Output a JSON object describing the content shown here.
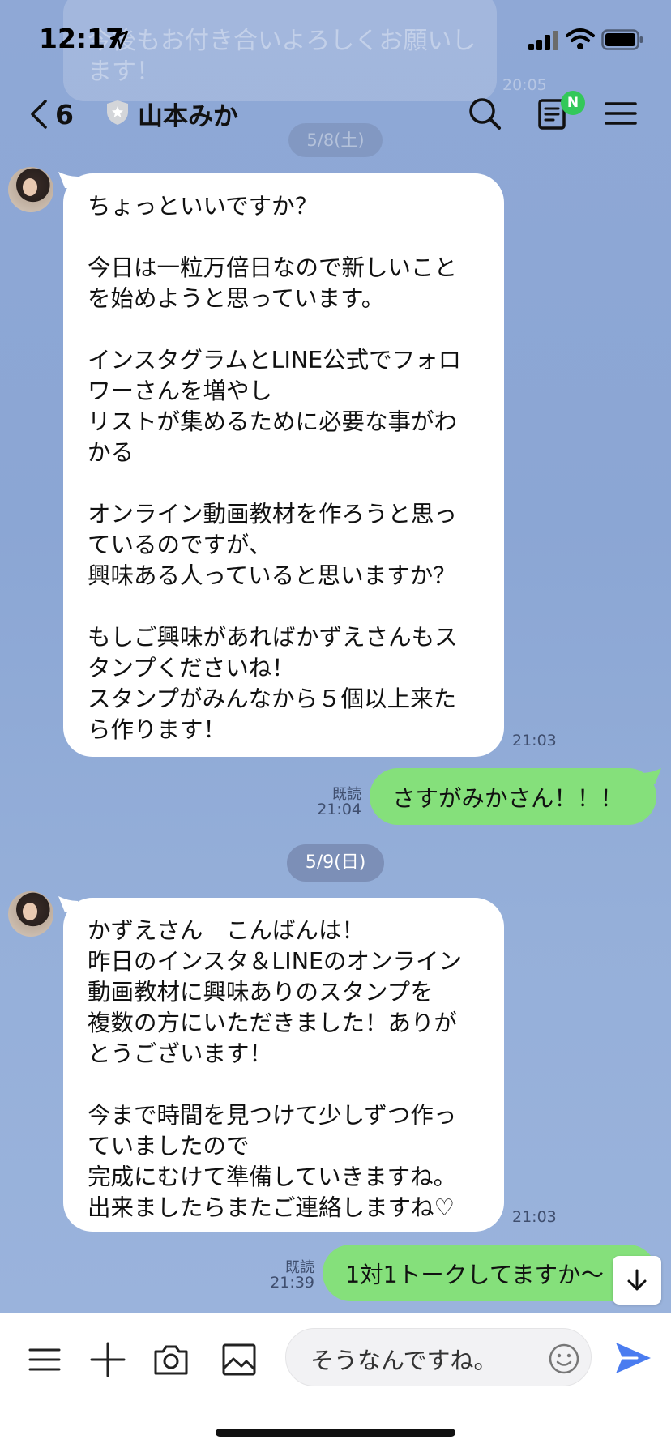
{
  "status_bar": {
    "time": "12:17"
  },
  "header": {
    "back_count": "6",
    "title": "山本みか",
    "notes_badge": "N"
  },
  "ghost_message": {
    "text": "今後もお付き合いよろしくお願いします！",
    "time": "20:05",
    "date": "5/8(土)"
  },
  "messages": [
    {
      "type": "received",
      "lines": [
        "ちょっといいですか？",
        "",
        "今日は一粒万倍日なので新しいこと",
        "を始めようと思っています。",
        "",
        "インスタグラムとLINE公式でフォロ",
        "ワーさんを増やし",
        "リストが集めるために必要な事がわ",
        "かる",
        "",
        "オンライン動画教材を作ろうと思っ",
        "ているのですが、",
        "興味ある人っていると思いますか？",
        "",
        "もしご興味があればかずえさんもス",
        "タンプくださいね！",
        "スタンプがみんなから５個以上来た",
        "ら作ります！"
      ],
      "time": "21:03"
    },
    {
      "type": "sent",
      "text": "さすがみかさん！！！",
      "read": "既読",
      "time": "21:04"
    },
    {
      "type": "received",
      "lines": [
        "かずえさん　こんばんは！",
        "昨日のインスタ＆LINEのオンライン",
        "動画教材に興味ありのスタンプを",
        "複数の方にいただきました！ありが",
        "とうございます！",
        "",
        "今まで時間を見つけて少しずつ作っ",
        "ていましたので",
        "完成にむけて準備していきますね。",
        "出来ましたらまたご連絡しますね♡"
      ],
      "time": "21:03"
    },
    {
      "type": "sent",
      "text": "1対1トークしてますか〜",
      "read": "既読",
      "time": "21:39"
    }
  ],
  "date_separator": "5/9(日)",
  "input_bar": {
    "draft_text": "そうなんですね。"
  },
  "colors": {
    "chat_background": "#8ea7d4",
    "sent_bubble": "#85e07b",
    "received_bubble": "#ffffff",
    "send_icon": "#4a7cf0",
    "badge": "#33c85a"
  },
  "icons": {
    "back": "chevron-left-icon",
    "search": "search-icon",
    "notes": "notes-icon",
    "menu": "menu-icon",
    "input_menu": "menu-icon",
    "add": "plus-icon",
    "camera": "camera-icon",
    "image": "image-icon",
    "emoji": "emoji-icon",
    "send": "send-icon",
    "scroll_down": "arrow-down-icon"
  }
}
